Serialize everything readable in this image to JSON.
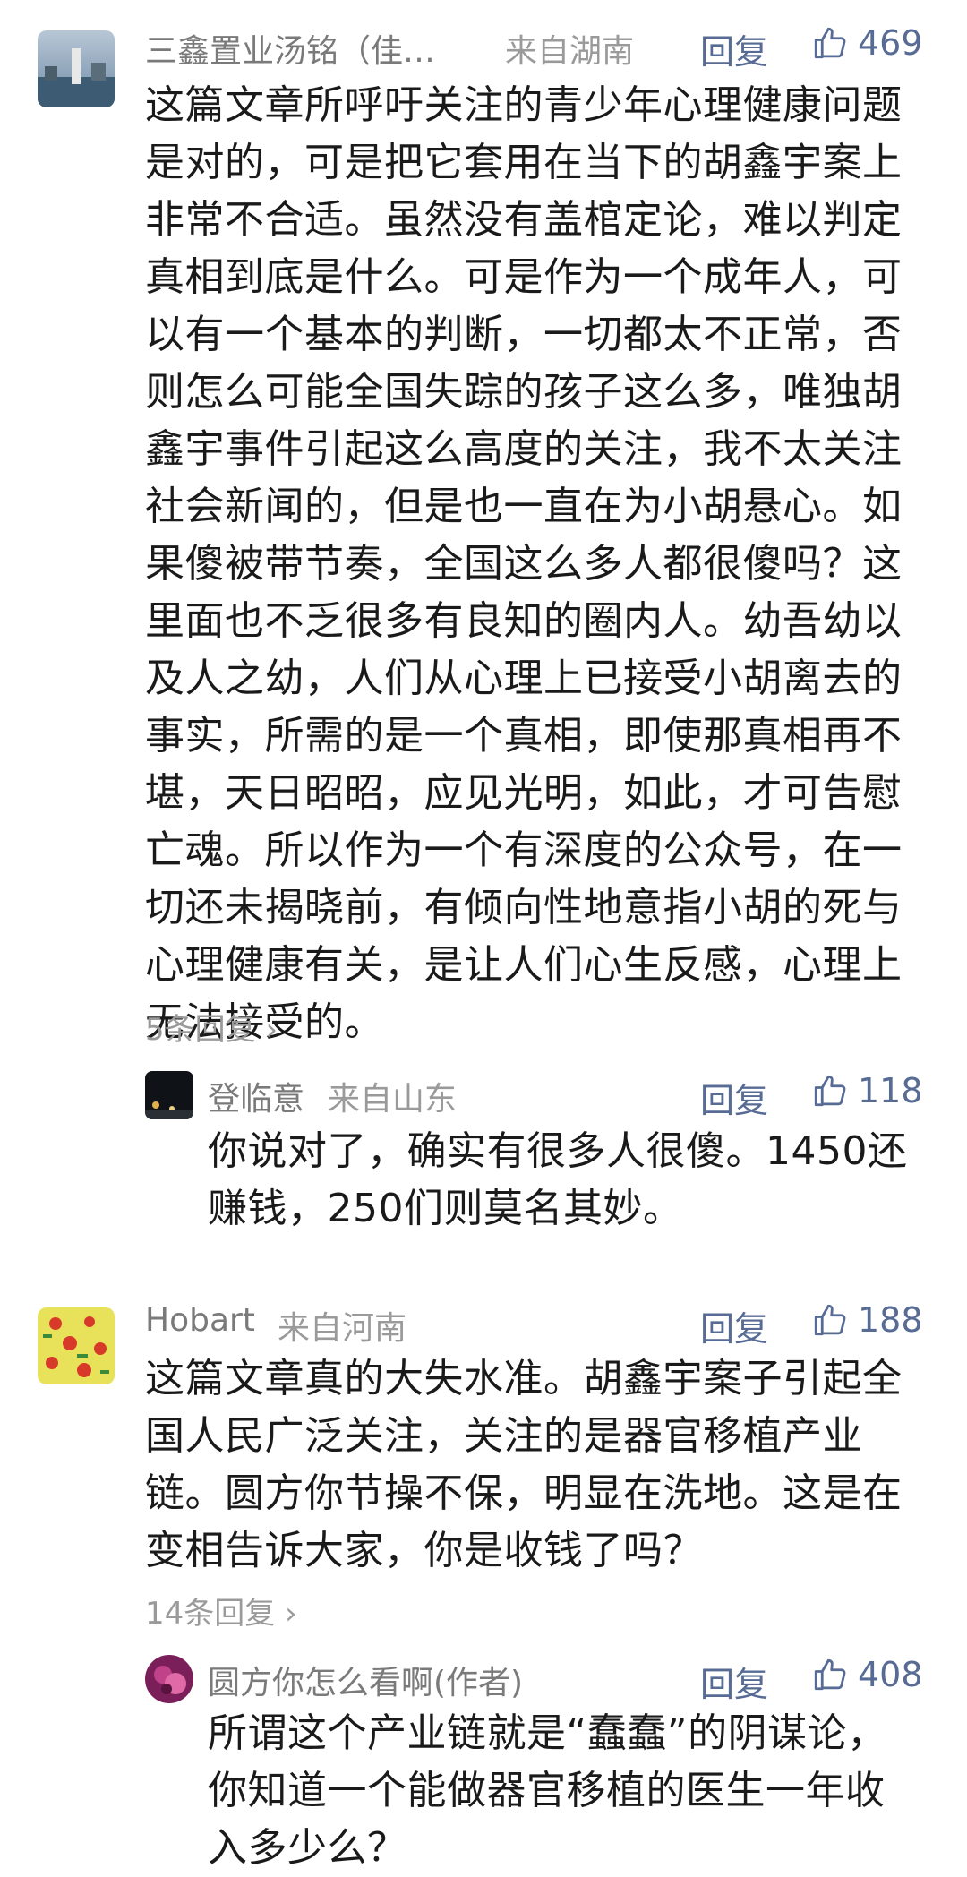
{
  "comments": [
    {
      "author": "三鑫置业汤铭（佳…",
      "location": "来自湖南",
      "reply_label": "回复",
      "likes": "469",
      "text": "这篇文章所呼吁关注的青少年心理健康问题是对的，可是把它套用在当下的胡鑫宇案上非常不合适。虽然没有盖棺定论，难以判定真相到底是什么。可是作为一个成年人，可以有一个基本的判断，一切都太不正常，否则怎么可能全国失踪的孩子这么多，唯独胡鑫宇事件引起这么高度的关注，我不太关注社会新闻的，但是也一直在为小胡悬心。如果傻被带节奏，全国这么多人都很傻吗？这里面也不乏很多有良知的圈内人。幼吾幼以及人之幼，人们从心理上已接受小胡离去的事实，所需的是一个真相，即使那真相再不堪，天日昭昭，应见光明，如此，才可告慰亡魂。所以作为一个有深度的公众号，在一切还未揭晓前，有倾向性地意指小胡的死与心理健康有关，是让人们心生反感，心理上无法接受的。",
      "more_replies": "5条回复",
      "reply": {
        "author": "登临意",
        "location": "来自山东",
        "reply_label": "回复",
        "likes": "118",
        "text": "你说对了，确实有很多人很傻。1450还赚钱，250们则莫名其妙。"
      }
    },
    {
      "author": "Hobart",
      "location": "来自河南",
      "reply_label": "回复",
      "likes": "188",
      "text": "这篇文章真的大失水准。胡鑫宇案子引起全国人民广泛关注，关注的是器官移植产业链。圆方你节操不保，明显在洗地。这是在变相告诉大家，你是收钱了吗？",
      "more_replies": "14条回复",
      "reply": {
        "author": "圆方你怎么看啊(作者)",
        "location": "",
        "reply_label": "回复",
        "likes": "408",
        "text": "所谓这个产业链就是“蠢蠢”的阴谋论，你知道一个能做器官移植的医生一年收入多少么？"
      }
    }
  ]
}
